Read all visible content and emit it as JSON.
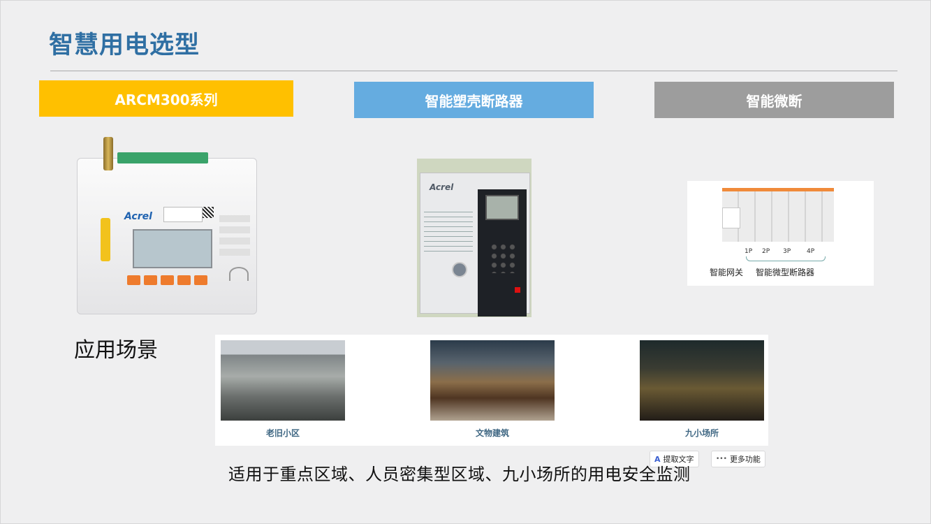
{
  "title": "智慧用电选型",
  "categories": [
    "ARCM300系列",
    "智能塑壳断路器",
    "智能微断"
  ],
  "arcm": {
    "brand": "Acrel"
  },
  "breaker": {
    "brand": "Acrel"
  },
  "mcb": {
    "poles": [
      "1P",
      "2P",
      "3P",
      "4P"
    ],
    "gateway_label": "智能网关",
    "breaker_label": "智能微型断路器"
  },
  "scene_label": "应用场景",
  "scenes": [
    "老旧小区",
    "文物建筑",
    "九小场所"
  ],
  "toolbar": {
    "extract_icon": "A",
    "extract_label": "提取文字",
    "more_icon": "•••",
    "more_label": "更多功能"
  },
  "bottom_text": "适用于重点区域、人员密集型区域、九小场所的用电安全监测"
}
